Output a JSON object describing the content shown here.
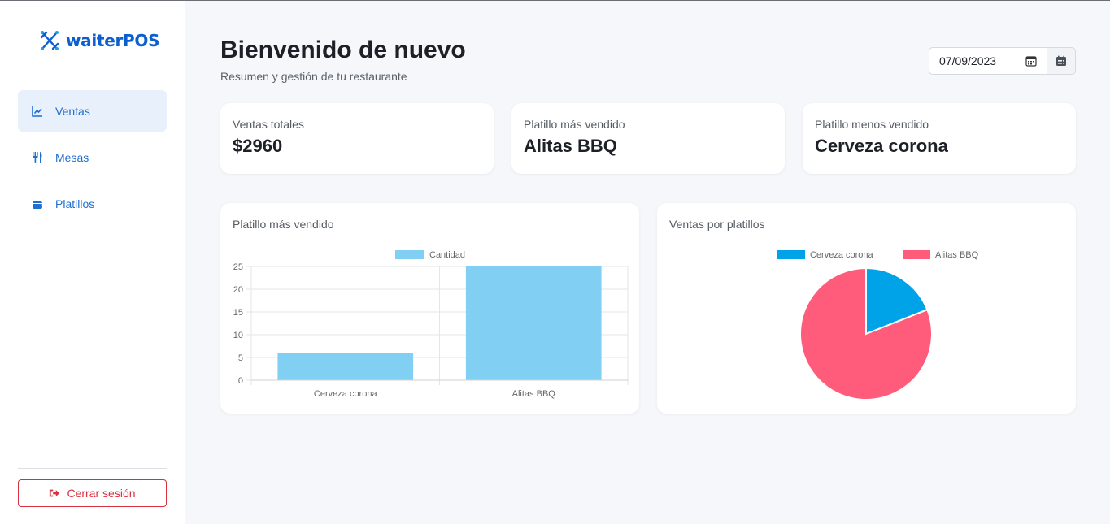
{
  "app": {
    "name": "waiterPOS"
  },
  "sidebar": {
    "items": [
      {
        "label": "Ventas",
        "icon": "chart-line-icon",
        "active": true
      },
      {
        "label": "Mesas",
        "icon": "utensils-icon",
        "active": false
      },
      {
        "label": "Platillos",
        "icon": "burger-icon",
        "active": false
      }
    ],
    "logout_label": "Cerrar sesión"
  },
  "header": {
    "title": "Bienvenido de nuevo",
    "subtitle": "Resumen y gestión de tu restaurante",
    "date_value": "07/09/2023"
  },
  "stats": [
    {
      "label": "Ventas totales",
      "value": "$2960"
    },
    {
      "label": "Platillo más vendido",
      "value": "Alitas BBQ"
    },
    {
      "label": "Platillo menos vendido",
      "value": "Cerveza corona"
    }
  ],
  "colors": {
    "accent": "#1f6fd1",
    "bar": "#81d0f4",
    "pie_1": "#00a3e8",
    "pie_2": "#ff5b7b",
    "danger": "#d9303e"
  },
  "chart_data": [
    {
      "type": "bar",
      "title": "Platillo más vendido",
      "categories": [
        "Cerveza corona",
        "Alitas BBQ"
      ],
      "series": [
        {
          "name": "Cantidad",
          "values": [
            6,
            25
          ]
        }
      ],
      "ylim": [
        0,
        25
      ],
      "yticks": [
        "0",
        "5",
        "10",
        "15",
        "20",
        "25"
      ],
      "legend": "top",
      "grid": true
    },
    {
      "type": "pie",
      "title": "Ventas por platillos",
      "categories": [
        "Cerveza corona",
        "Alitas BBQ"
      ],
      "values": [
        19,
        81
      ],
      "legend": "top"
    }
  ]
}
